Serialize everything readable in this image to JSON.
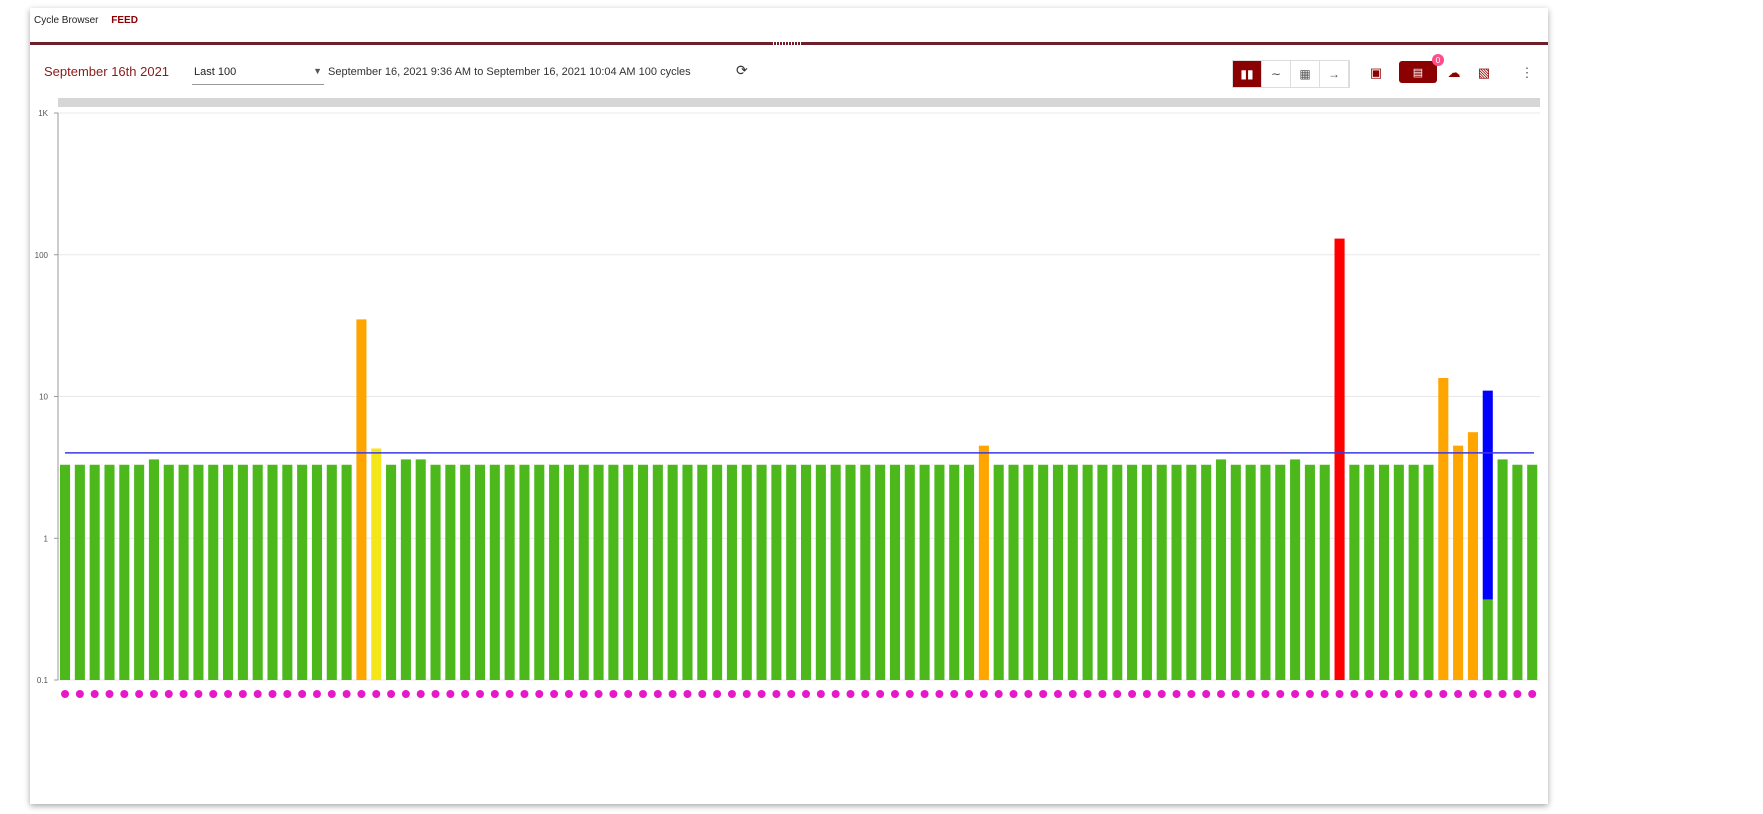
{
  "breadcrumb": {
    "item1": "Cycle Browser",
    "item2": "FEED"
  },
  "toolbar": {
    "date_title": "September 16th 2021",
    "range_select": "Last 100",
    "range_text": "September 16, 2021 9:36 AM to September 16, 2021 10:04 AM 100 cycles",
    "badge_count": "0",
    "icons": {
      "refresh": "refresh-icon",
      "bar_chart": "bar-chart-icon",
      "line_chart": "line-chart-icon",
      "table": "grid-icon",
      "arrow": "arrow-right-icon",
      "note": "note-icon",
      "chat": "chat-icon",
      "cloud": "cloud-download-icon",
      "export": "export-icon",
      "more": "more-vert-icon"
    }
  },
  "colors": {
    "accent": "#8b0000",
    "bar_normal": "#4cb81c",
    "bar_warn": "#ffa500",
    "bar_caution": "#f5e61a",
    "bar_alarm": "#ff0000",
    "bar_blue": "#0000ff",
    "threshold_line": "#3a3ae6",
    "marker": "#e619c8"
  },
  "chart_data": {
    "type": "bar",
    "y_scale": "log",
    "ylim": [
      0.1,
      1000
    ],
    "y_ticks": [
      "0.1",
      "1",
      "10",
      "100",
      "1K"
    ],
    "threshold": 4,
    "grid": "horizontal",
    "values": [
      3.3,
      3.3,
      3.3,
      3.3,
      3.3,
      3.3,
      3.6,
      3.3,
      3.3,
      3.3,
      3.3,
      3.3,
      3.3,
      3.3,
      3.3,
      3.3,
      3.3,
      3.3,
      3.3,
      3.3,
      35,
      4.3,
      3.3,
      3.6,
      3.6,
      3.3,
      3.3,
      3.3,
      3.3,
      3.3,
      3.3,
      3.3,
      3.3,
      3.3,
      3.3,
      3.3,
      3.3,
      3.3,
      3.3,
      3.3,
      3.3,
      3.3,
      3.3,
      3.3,
      3.3,
      3.3,
      3.3,
      3.3,
      3.3,
      3.3,
      3.3,
      3.3,
      3.3,
      3.3,
      3.3,
      3.3,
      3.3,
      3.3,
      3.3,
      3.3,
      3.3,
      3.3,
      3.3,
      3.3,
      3.3,
      3.3,
      3.3,
      3.3,
      3.3,
      3.3,
      3.3,
      3.3,
      3.3,
      3.3,
      3.3,
      3.3,
      3.3,
      3.3,
      3.6,
      3.3,
      3.3,
      3.3,
      3.3,
      3.6,
      3.3,
      3.3,
      3.3,
      3.3,
      3.3,
      3.3,
      3.3,
      3.3,
      3.3,
      3.3,
      3.3,
      3.3,
      3.3,
      3.3,
      3.3,
      3.3
    ],
    "status": [
      "normal",
      "normal",
      "normal",
      "normal",
      "normal",
      "normal",
      "normal",
      "normal",
      "normal",
      "normal",
      "normal",
      "normal",
      "normal",
      "normal",
      "normal",
      "normal",
      "normal",
      "normal",
      "normal",
      "normal",
      "warn",
      "caution",
      "normal",
      "normal",
      "normal",
      "normal",
      "normal",
      "normal",
      "normal",
      "normal",
      "normal",
      "normal",
      "normal",
      "normal",
      "normal",
      "normal",
      "normal",
      "normal",
      "normal",
      "normal",
      "normal",
      "normal",
      "normal",
      "normal",
      "normal",
      "normal",
      "normal",
      "normal",
      "normal",
      "normal",
      "normal",
      "normal",
      "normal",
      "normal",
      "normal",
      "normal",
      "normal",
      "normal",
      "normal",
      "normal",
      "normal",
      "normal",
      "normal",
      "normal",
      "normal",
      "normal",
      "normal",
      "normal",
      "normal",
      "normal",
      "normal",
      "normal",
      "normal",
      "normal",
      "normal",
      "normal",
      "normal",
      "normal",
      "normal",
      "normal",
      "normal",
      "normal",
      "normal",
      "normal",
      "normal",
      "normal",
      "normal",
      "normal",
      "normal",
      "normal",
      "normal",
      "normal",
      "normal",
      "normal",
      "normal",
      "normal",
      "normal",
      "normal",
      "normal",
      "normal"
    ],
    "overrides": [
      {
        "index": 62,
        "value": 4.5,
        "status": "warn"
      },
      {
        "index": 86,
        "value": 130,
        "status": "alarm"
      },
      {
        "index": 93,
        "value": 13.5,
        "status": "warn"
      },
      {
        "index": 94,
        "value": 4.5,
        "status": "warn"
      },
      {
        "index": 95,
        "value": 5.6,
        "status": "warn"
      },
      {
        "index": 96,
        "value": 11,
        "status": "blue_over_green",
        "green_value": 0.37
      },
      {
        "index": 97,
        "value": 3.6,
        "status": "normal"
      }
    ]
  }
}
